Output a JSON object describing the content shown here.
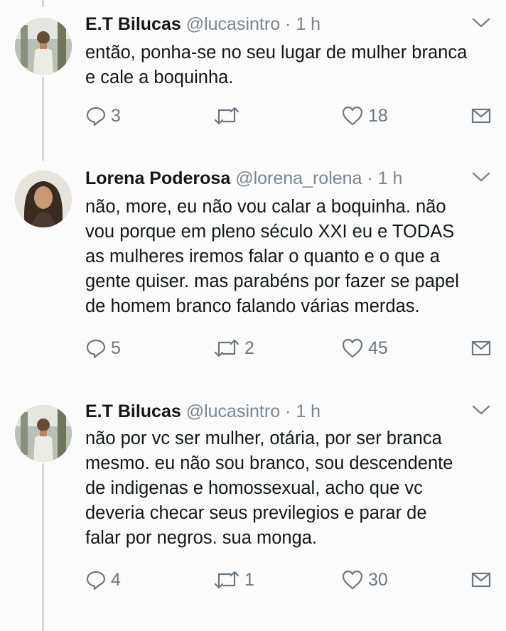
{
  "tweets": [
    {
      "author": "E.T Bilucas",
      "handle": "@lucasintro",
      "separator": "·",
      "time": "1 h",
      "text": "então, ponha-se no seu lugar de mulher branca\ne cale a boquinha.",
      "replies": "3",
      "retweets": "",
      "likes": "18"
    },
    {
      "author": "Lorena Poderosa",
      "handle": "@lorena_rolena",
      "separator": "·",
      "time": "1 h",
      "text": "não, more, eu não vou calar a boquinha. não\nvou porque em pleno século XXI eu e TODAS\nas mulheres iremos falar o quanto e o que a\ngente quiser. mas parabéns por fazer se papel\nde homem branco falando várias merdas.",
      "replies": "5",
      "retweets": "2",
      "likes": "45"
    },
    {
      "author": "E.T Bilucas",
      "handle": "@lucasintro",
      "separator": "·",
      "time": "1 h",
      "text": "não por vc ser mulher, otária, por ser branca\nmesmo. eu não sou branco, sou descendente\nde indigenas e homossexual, acho que vc\ndeveria checar seus previlegios e parar de\nfalar por negros. sua monga.",
      "replies": "4",
      "retweets": "1",
      "likes": "30"
    }
  ],
  "colors": {
    "background": "#fbfbfb",
    "text": "#14171a",
    "muted": "#7a8690",
    "thread_line": "#cfd6dc"
  },
  "icons": [
    "reply-icon",
    "retweet-icon",
    "like-icon",
    "direct-message-icon",
    "chevron-down-icon"
  ]
}
